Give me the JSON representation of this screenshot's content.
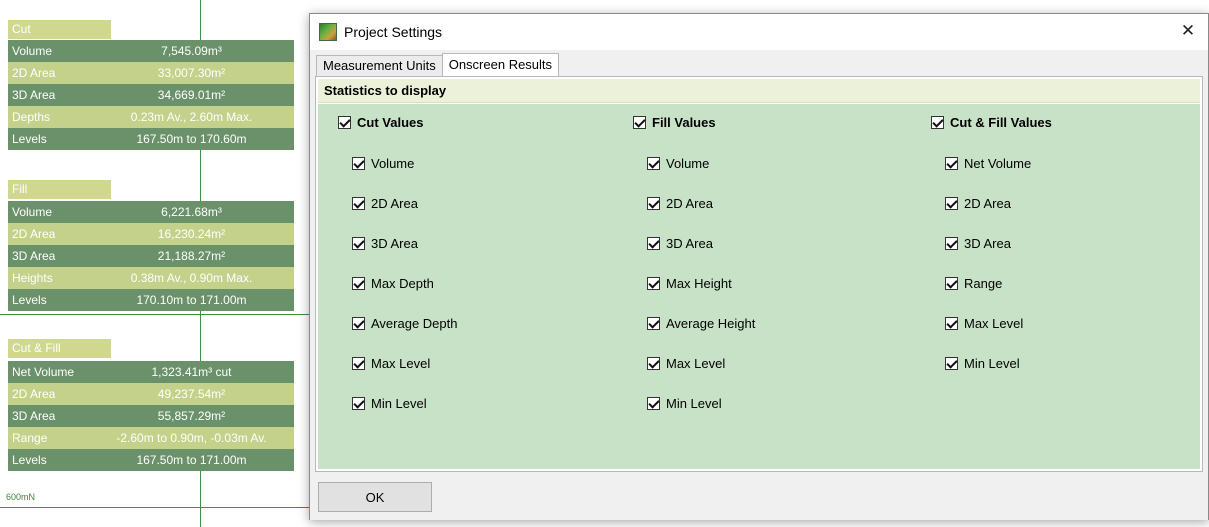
{
  "background": {
    "cut_panel": {
      "title": "Cut",
      "rows": [
        {
          "label": "Volume",
          "value": "7,545.09m³"
        },
        {
          "label": "2D Area",
          "value": "33,007.30m²"
        },
        {
          "label": "3D Area",
          "value": "34,669.01m²"
        },
        {
          "label": "Depths",
          "value": "0.23m Av., 2.60m Max."
        },
        {
          "label": "Levels",
          "value": "167.50m to 170.60m"
        }
      ]
    },
    "fill_panel": {
      "title": "Fill",
      "rows": [
        {
          "label": "Volume",
          "value": "6,221.68m³"
        },
        {
          "label": "2D Area",
          "value": "16,230.24m²"
        },
        {
          "label": "3D Area",
          "value": "21,188.27m²"
        },
        {
          "label": "Heights",
          "value": "0.38m Av., 0.90m Max."
        },
        {
          "label": "Levels",
          "value": "170.10m to 171.00m"
        }
      ]
    },
    "cutfill_panel": {
      "title": "Cut & Fill",
      "rows": [
        {
          "label": "Net Volume",
          "value": "1,323.41m³ cut"
        },
        {
          "label": "2D Area",
          "value": "49,237.54m²"
        },
        {
          "label": "3D Area",
          "value": "55,857.29m²"
        },
        {
          "label": "Range",
          "value": "-2.60m to 0.90m, -0.03m Av."
        },
        {
          "label": "Levels",
          "value": "167.50m to 171.00m"
        }
      ]
    },
    "scale_label": "600mN"
  },
  "dialog": {
    "title": "Project Settings",
    "close_glyph": "✕",
    "tabs": [
      {
        "label": "Measurement Units",
        "active": false
      },
      {
        "label": "Onscreen Results",
        "active": true
      }
    ],
    "section_header": "Statistics to display",
    "columns": [
      {
        "header": "Cut Values",
        "items": [
          "Volume",
          "2D Area",
          "3D Area",
          "Max Depth",
          "Average Depth",
          "Max Level",
          "Min Level"
        ]
      },
      {
        "header": "Fill Values",
        "items": [
          "Volume",
          "2D Area",
          "3D Area",
          "Max Height",
          "Average Height",
          "Max Level",
          "Min Level"
        ]
      },
      {
        "header": "Cut & Fill Values",
        "items": [
          "Net Volume",
          "2D Area",
          "3D Area",
          "Range",
          "Max Level",
          "Min Level"
        ]
      }
    ],
    "ok_label": "OK"
  },
  "colors": {
    "stats_background": "#c8e2c8",
    "section_header_bg": "#ecf1da",
    "panel_dark_row": "#6a9169",
    "panel_light_row": "#c3d18b",
    "grid_line": "#3f8f3f"
  }
}
